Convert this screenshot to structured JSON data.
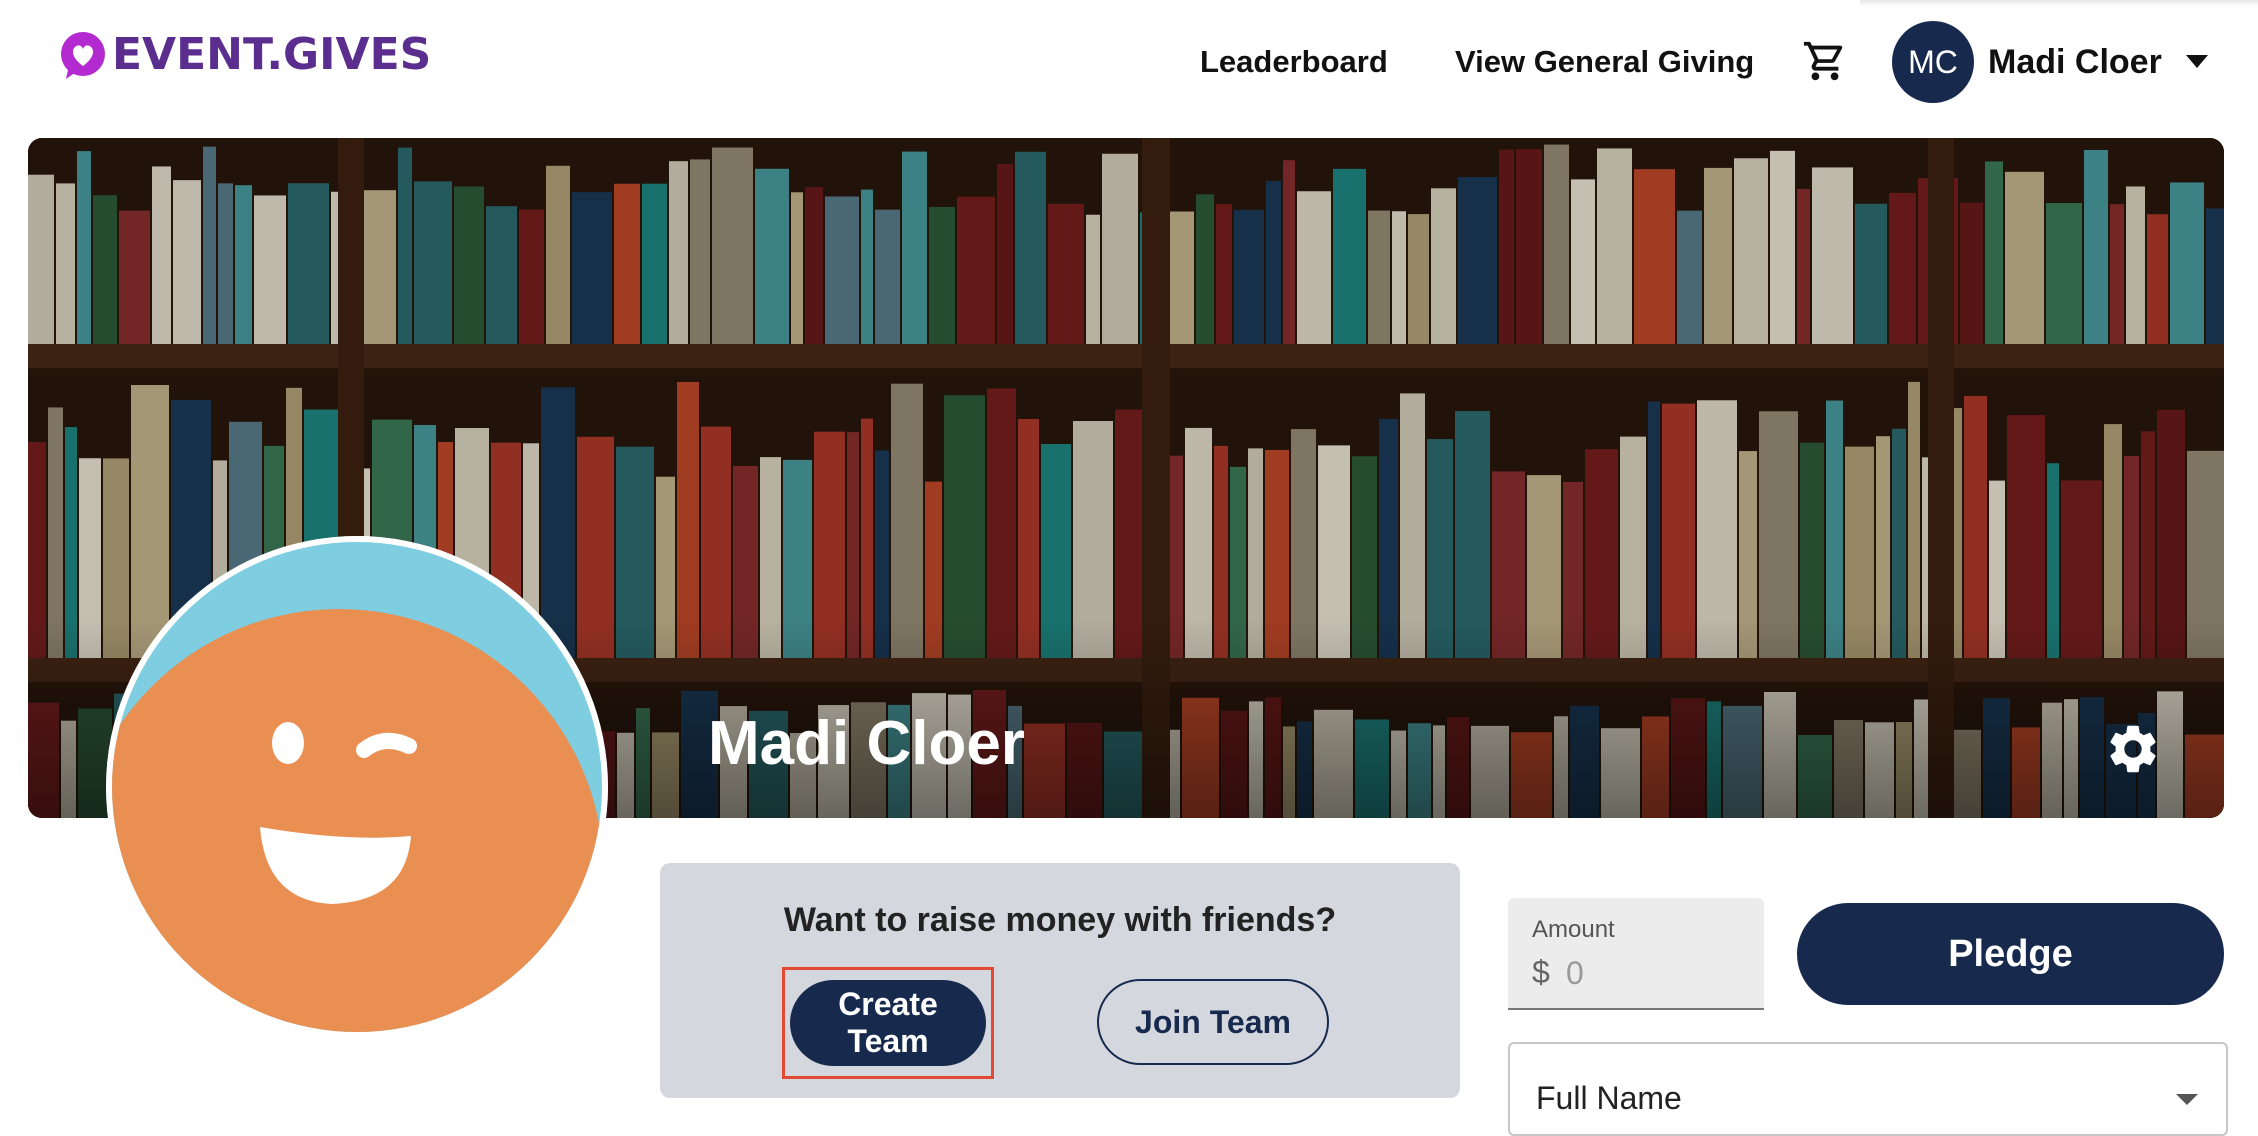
{
  "header": {
    "logo_text": "EVENT.GIVES",
    "nav": [
      {
        "label": "Leaderboard"
      },
      {
        "label": "View General Giving"
      }
    ],
    "cart_icon": "shopping-cart-icon",
    "user": {
      "initials": "MC",
      "name": "Madi Cloer",
      "menu_icon": "caret-down-icon"
    }
  },
  "banner": {
    "name": "Madi Cloer",
    "settings_icon": "gear-icon"
  },
  "team": {
    "prompt": "Want to raise money with friends?",
    "create_label": "Create Team",
    "join_label": "Join Team"
  },
  "pledge": {
    "amount_label": "Amount",
    "currency_symbol": "$",
    "amount_placeholder": "0",
    "pledge_label": "Pledge",
    "name_field_label": "Full Name"
  },
  "colors": {
    "brand_purple": "#5b2d8e",
    "logo_heart": "#b32bd0",
    "navy": "#172a4e",
    "card_gray": "#d4d7de",
    "highlight": "#e34a33",
    "avatar_blue": "#7ecde1",
    "avatar_orange": "#e98f52"
  }
}
